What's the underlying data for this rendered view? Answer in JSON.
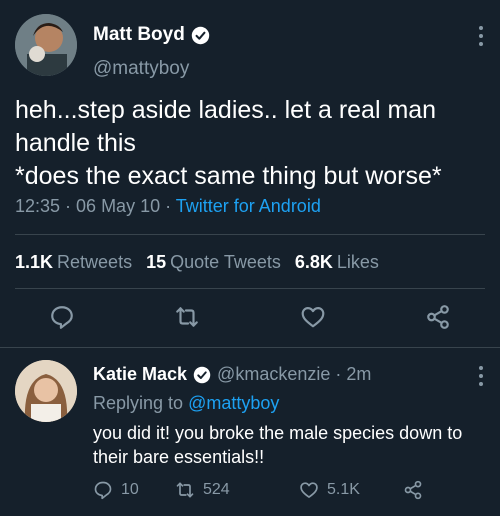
{
  "main_tweet": {
    "display_name": "Matt Boyd",
    "handle": "@mattyboy",
    "text": "heh...step aside ladies.. let a real man handle this\n*does the exact same thing but worse*",
    "time": "12:35 · 06 May 10 · ",
    "source": "Twitter for Android",
    "stats": {
      "retweets_count": "1.1K",
      "retweets_label": "Retweets",
      "quotes_count": "15",
      "quotes_label": "Quote Tweets",
      "likes_count": "6.8K",
      "likes_label": "Likes"
    }
  },
  "reply_tweet": {
    "display_name": "Katie Mack",
    "handle": "@kmackenzie · 2m",
    "replying_prefix": "Replying to ",
    "replying_to": "@mattyboy",
    "text": "you did it! you broke the male species down to their bare essentials!!",
    "replies": "10",
    "retweets": "524",
    "likes": "5.1K"
  },
  "icons": [
    "verified-icon",
    "more-icon",
    "reply-icon",
    "retweet-icon",
    "like-icon",
    "share-icon"
  ],
  "colors": {
    "background": "#15202b",
    "accent": "#1da1f2",
    "muted": "#8899a6",
    "divider": "#38444d"
  }
}
